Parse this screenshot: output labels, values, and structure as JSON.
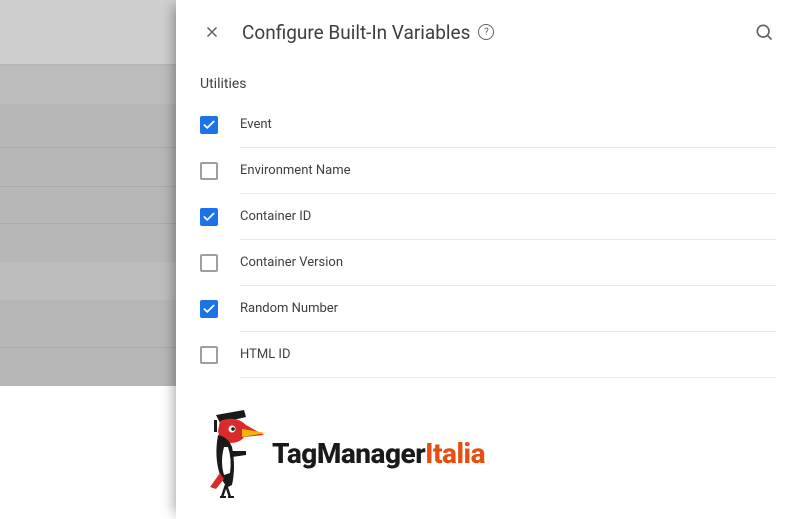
{
  "header": {
    "title": "Configure Built-In Variables"
  },
  "section": {
    "title": "Utilities"
  },
  "variables": [
    {
      "label": "Event",
      "checked": true
    },
    {
      "label": "Environment Name",
      "checked": false
    },
    {
      "label": "Container ID",
      "checked": true
    },
    {
      "label": "Container Version",
      "checked": false
    },
    {
      "label": "Random Number",
      "checked": true
    },
    {
      "label": "HTML ID",
      "checked": false
    }
  ],
  "logo": {
    "text1": "TagManager",
    "text2": "Italia"
  }
}
